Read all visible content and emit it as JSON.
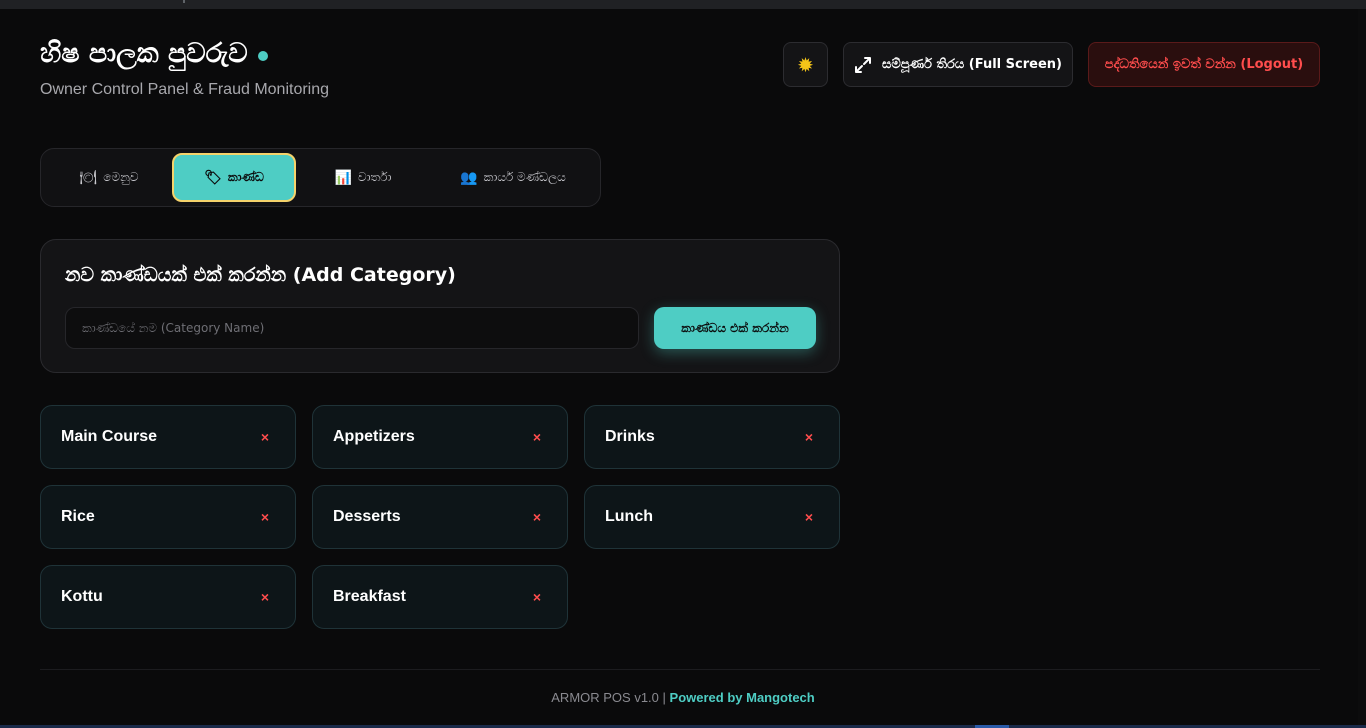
{
  "header": {
    "title": "හිෂ පාලක පුවරුව",
    "subtitle": "Owner Control Panel & Fraud Monitoring",
    "theme_icon": "sun-icon",
    "fullscreen_label": "සම්පූර්ණ තිරය (Full Screen)",
    "logout_label": "පද්ධතියෙන් ඉවත් වන්න (Logout)"
  },
  "tabs": [
    {
      "icon": "🍽",
      "label": "මෙනුව",
      "active": false
    },
    {
      "icon": "🏷",
      "label": "කාණ්ඩ",
      "active": true
    },
    {
      "icon": "📊",
      "label": "වාර්තා",
      "active": false
    },
    {
      "icon": "👥",
      "label": "කාර්ය මණ්ඩලය",
      "active": false
    }
  ],
  "add_category": {
    "title": "නව කාණ්ඩයක් එක් කරන්න (Add Category)",
    "input_value": "",
    "input_placeholder": "කාණ්ඩයේ නම (Category Name)",
    "button_label": "කාණ්ඩය එක් කරන්න"
  },
  "categories": [
    {
      "name": "Main Course",
      "delete": "×"
    },
    {
      "name": "Appetizers",
      "delete": "×"
    },
    {
      "name": "Drinks",
      "delete": "×"
    },
    {
      "name": "Rice",
      "delete": "×"
    },
    {
      "name": "Desserts",
      "delete": "×"
    },
    {
      "name": "Lunch",
      "delete": "×"
    },
    {
      "name": "Kottu",
      "delete": "×"
    },
    {
      "name": "Breakfast",
      "delete": "×"
    }
  ],
  "footer": {
    "version": "ARMOR POS v1.0 |",
    "powered": "Powered by Mangotech"
  },
  "colors": {
    "accent": "#4ecdc4",
    "danger": "#ff4d4d",
    "background": "#0a0a0b",
    "active_tab_border": "#f5d36b"
  }
}
